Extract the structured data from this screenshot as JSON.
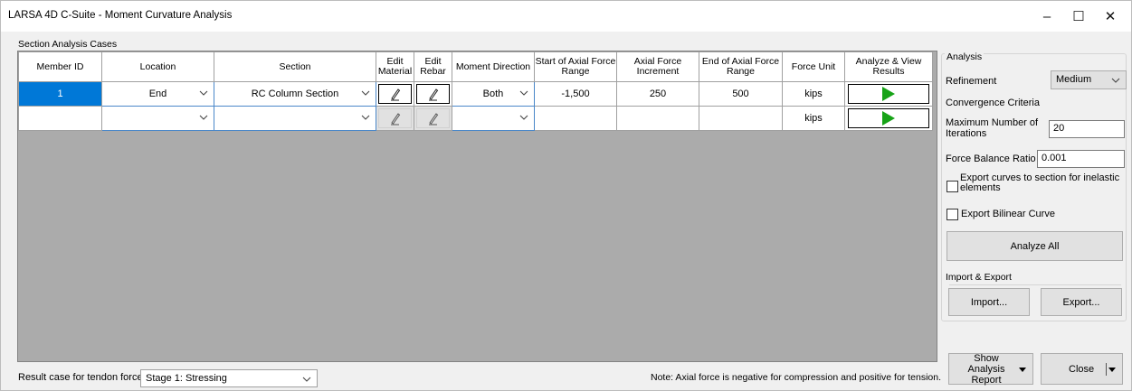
{
  "window": {
    "title": "LARSA 4D C-Suite - Moment Curvature Analysis",
    "minimize": "–",
    "maximize": "☐",
    "close": "✕"
  },
  "section_label": "Section Analysis Cases",
  "grid": {
    "columns": [
      "Member ID",
      "Location",
      "Section",
      "Edit Material",
      "Edit Rebar",
      "Moment Direction",
      "Start of Axial Force Range",
      "Axial Force Increment",
      "End of Axial Force Range",
      "Force Unit",
      "Analyze & View Results"
    ],
    "rows": [
      {
        "member_id": "1",
        "location": "End",
        "section": "RC Column Section",
        "moment_direction": "Both",
        "start_axial": "-1,500",
        "increment": "250",
        "end_axial": "500",
        "force_unit": "kips"
      },
      {
        "member_id": "",
        "location": "",
        "section": "",
        "moment_direction": "",
        "start_axial": "",
        "increment": "",
        "end_axial": "",
        "force_unit": "kips"
      }
    ]
  },
  "bottom": {
    "result_case_label": "Result case for tendon forces",
    "result_case_value": "Stage 1: Stressing",
    "note": "Note: Axial force is negative for compression and positive for tension."
  },
  "analysis": {
    "group_title": "Analysis",
    "refinement_label": "Refinement",
    "refinement_value": "Medium",
    "convergence_label": "Convergence Criteria",
    "max_iter_label": "Maximum Number of Iterations",
    "max_iter_value": "20",
    "force_balance_label": "Force Balance Ratio",
    "force_balance_value": "0.001",
    "export_curves_label": "Export curves to section for inelastic elements",
    "export_curves_checked": false,
    "export_bilinear_label": "Export Bilinear Curve",
    "export_bilinear_checked": false,
    "analyze_all": "Analyze All"
  },
  "import_export": {
    "title": "Import & Export",
    "import": "Import...",
    "export": "Export..."
  },
  "footer_buttons": {
    "show_report": "Show Analysis Report",
    "close": "Close"
  }
}
